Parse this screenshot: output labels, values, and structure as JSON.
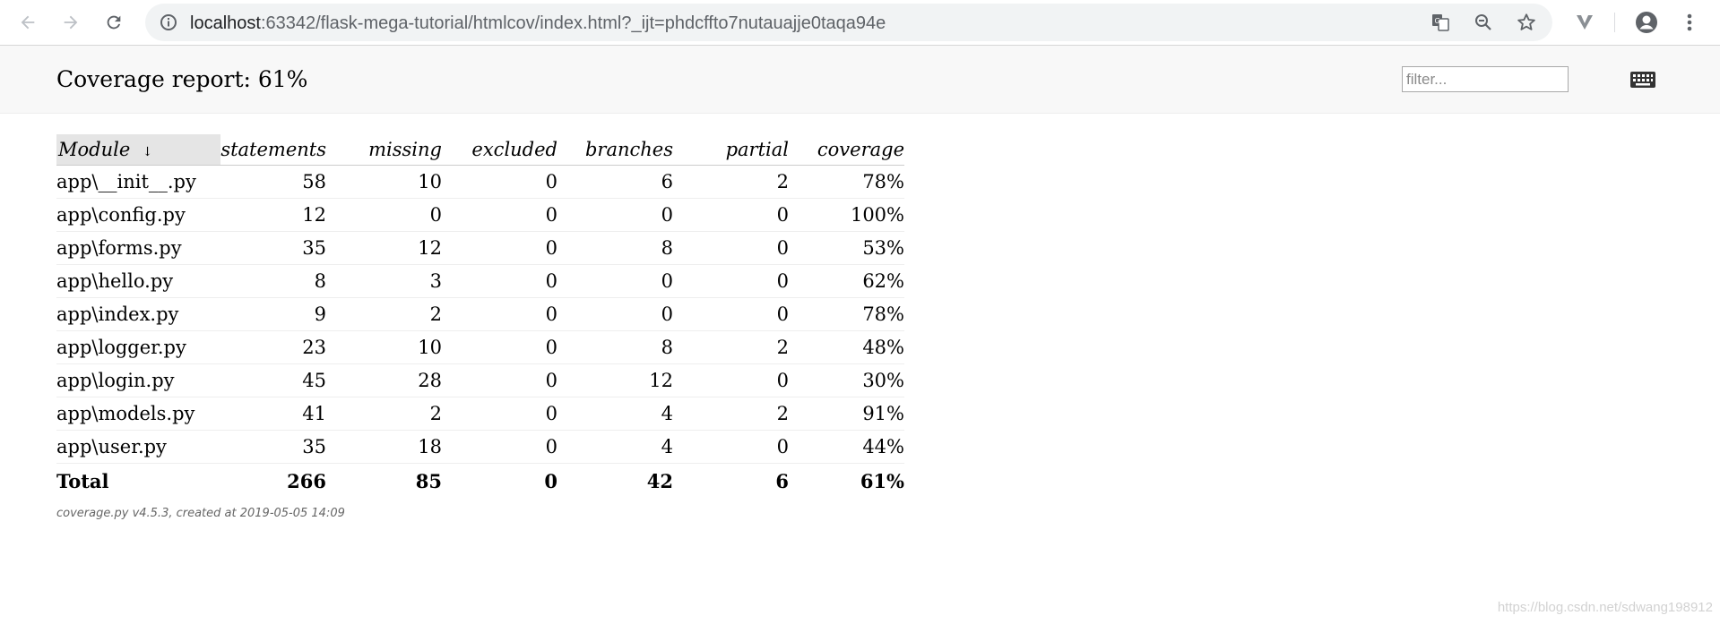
{
  "browser": {
    "url_host": "localhost",
    "url_rest": ":63342/flask-mega-tutorial/htmlcov/index.html?_ijt=phdcffto7nutauajje0taqa94e"
  },
  "report": {
    "title": "Coverage report: 61%",
    "filter_placeholder": "filter...",
    "columns": [
      "Module",
      "statements",
      "missing",
      "excluded",
      "branches",
      "partial",
      "coverage"
    ],
    "sort_indicator": "↓",
    "rows": [
      [
        "app\\__init__.py",
        "58",
        "10",
        "0",
        "6",
        "2",
        "78%"
      ],
      [
        "app\\config.py",
        "12",
        "0",
        "0",
        "0",
        "0",
        "100%"
      ],
      [
        "app\\forms.py",
        "35",
        "12",
        "0",
        "8",
        "0",
        "53%"
      ],
      [
        "app\\hello.py",
        "8",
        "3",
        "0",
        "0",
        "0",
        "62%"
      ],
      [
        "app\\index.py",
        "9",
        "2",
        "0",
        "0",
        "0",
        "78%"
      ],
      [
        "app\\logger.py",
        "23",
        "10",
        "0",
        "8",
        "2",
        "48%"
      ],
      [
        "app\\login.py",
        "45",
        "28",
        "0",
        "12",
        "0",
        "30%"
      ],
      [
        "app\\models.py",
        "41",
        "2",
        "0",
        "4",
        "2",
        "91%"
      ],
      [
        "app\\user.py",
        "35",
        "18",
        "0",
        "4",
        "0",
        "44%"
      ]
    ],
    "total": [
      "Total",
      "266",
      "85",
      "0",
      "42",
      "6",
      "61%"
    ],
    "footer": "coverage.py v4.5.3, created at 2019-05-05 14:09"
  },
  "watermark": "https://blog.csdn.net/sdwang198912"
}
